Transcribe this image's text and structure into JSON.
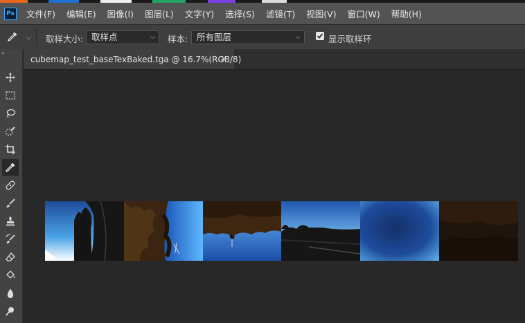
{
  "menubar": {
    "app_icon": "Ps",
    "items": [
      {
        "label": "文件(F)"
      },
      {
        "label": "编辑(E)"
      },
      {
        "label": "图像(I)"
      },
      {
        "label": "图层(L)"
      },
      {
        "label": "文字(Y)"
      },
      {
        "label": "选择(S)"
      },
      {
        "label": "滤镜(T)"
      },
      {
        "label": "视图(V)"
      },
      {
        "label": "窗口(W)"
      },
      {
        "label": "帮助(H)"
      }
    ]
  },
  "options": {
    "tool_icon": "eyedropper-icon",
    "sample_size_label": "取样大小:",
    "sample_size_value": "取样点",
    "sample_label": "样本:",
    "sample_value": "所有图层",
    "show_ring_label": "显示取样环",
    "show_ring_checked": true
  },
  "document": {
    "tab_title": "cubemap_test_baseTexBaked.tga @ 16.7%(RGB/8)",
    "close_icon": "×"
  },
  "toolbar": {
    "collapse_icon": "»",
    "tools": [
      {
        "name": "move-tool-icon"
      },
      {
        "name": "marquee-tool-icon"
      },
      {
        "name": "lasso-tool-icon"
      },
      {
        "name": "quick-selection-tool-icon"
      },
      {
        "name": "crop-tool-icon"
      },
      {
        "name": "eyedropper-tool-icon",
        "active": true
      },
      {
        "name": "healing-brush-tool-icon"
      },
      {
        "name": "brush-tool-icon"
      },
      {
        "name": "clone-stamp-tool-icon"
      },
      {
        "name": "history-brush-tool-icon"
      },
      {
        "name": "eraser-tool-icon"
      },
      {
        "name": "paint-bucket-tool-icon"
      },
      {
        "name": "blur-tool-icon"
      },
      {
        "name": "dodge-tool-icon"
      }
    ]
  },
  "colors": {
    "menubar_bg": "#535353",
    "options_bg": "#3e3e3e",
    "canvas_bg": "#282828",
    "accent": "#31a8ff"
  }
}
